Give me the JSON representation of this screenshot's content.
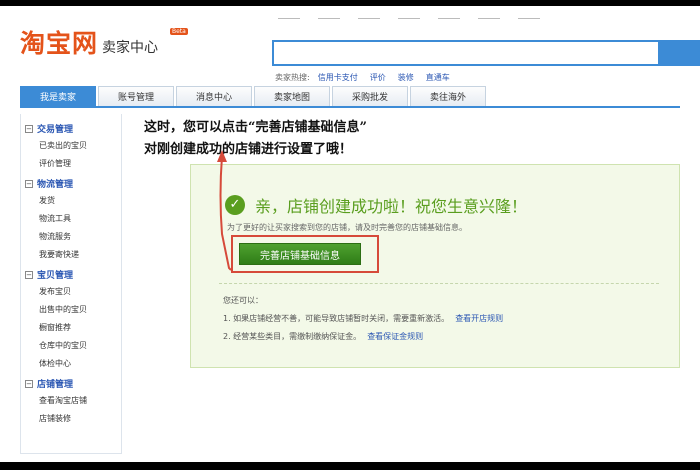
{
  "header": {
    "logo_main": "淘宝网",
    "logo_sub": "卖家中心",
    "logo_badge": "Beta",
    "hot_label": "卖家热搜:",
    "hot_links": [
      "信用卡支付",
      "评价",
      "装修",
      "直通车"
    ]
  },
  "nav": {
    "tabs": [
      {
        "label": "我是卖家",
        "active": true
      },
      {
        "label": "账号管理",
        "active": false
      },
      {
        "label": "消息中心",
        "active": false
      },
      {
        "label": "卖家地图",
        "active": false
      },
      {
        "label": "采购批发",
        "active": false
      },
      {
        "label": "卖往海外",
        "active": false
      }
    ]
  },
  "sidebar": {
    "groups": [
      {
        "title": "交易管理",
        "items": [
          "已卖出的宝贝",
          "评价管理"
        ]
      },
      {
        "title": "物流管理",
        "items": [
          "发货",
          "物流工具",
          "物流服务",
          "我要寄快递"
        ]
      },
      {
        "title": "宝贝管理",
        "items": [
          "发布宝贝",
          "出售中的宝贝",
          "橱窗推荐",
          "仓库中的宝贝",
          "体检中心"
        ]
      },
      {
        "title": "店铺管理",
        "items": [
          "查看淘宝店铺",
          "店铺装修"
        ]
      }
    ]
  },
  "annotation": {
    "line1": "这时，您可以点击“完善店铺基础信息”",
    "line2": "对刚创建成功的店铺进行设置了哦！"
  },
  "success": {
    "title": "亲，店铺创建成功啦！祝您生意兴隆！",
    "hint": "为了更好的让买家搜索到您的店铺，请及时完善您的店铺基础信息。",
    "button_label": "完善店铺基础信息",
    "remind_label": "您还可以：",
    "tips": [
      {
        "text": "1. 如果店铺经营不善，可能导致店铺暂时关闭，需要重新激活。",
        "link": "查看开店规则"
      },
      {
        "text": "2. 经营某些类目，需缴制缴纳保证金。",
        "link": "查看保证金规则"
      }
    ]
  },
  "colors": {
    "brand_orange": "#e4531a",
    "nav_blue": "#3c8bd6",
    "success_green": "#5a9e1f",
    "annotation_red": "#d64a3a"
  }
}
